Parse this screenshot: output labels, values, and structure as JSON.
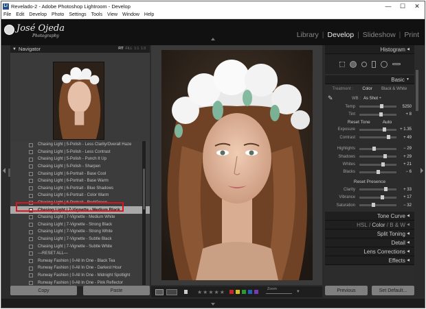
{
  "window": {
    "title": "Revelado-2 - Adobe Photoshop Lightroom - Develop",
    "app_badge": "Lr",
    "controls": {
      "minimize": "—",
      "maximize": "☐",
      "close": "✕"
    }
  },
  "menu": [
    "File",
    "Edit",
    "Develop",
    "Photo",
    "Settings",
    "Tools",
    "View",
    "Window",
    "Help"
  ],
  "identity": {
    "name": "José Ojeda",
    "subtitle": "Photography"
  },
  "modules": {
    "library": "Library",
    "develop": "Develop",
    "slideshow": "Slideshow",
    "print": "Print",
    "separator": "|",
    "active": "Develop"
  },
  "navigator": {
    "title": "Navigator",
    "zoom_options": {
      "fit": "FIT",
      "fill": "FILL",
      "one": "1:1",
      "three": "1:3"
    }
  },
  "presets": [
    "Chasing Light | 5-Polish - Less Clarity/Overall Haze",
    "Chasing Light | 5-Polish - Less Contrast",
    "Chasing Light | 5-Polish - Punch It Up",
    "Chasing Light | 5-Polish - Sharpen",
    "Chasing Light | 6-Portrait - Base Cool",
    "Chasing Light | 6-Portrait - Base Warm",
    "Chasing Light | 6-Portrait - Blue Shadows",
    "Chasing Light | 6-Portrait - Color Warm",
    "Chasing Light | 6-Portrait - Red/Green",
    "Chasing Light | 7-Vignette - Medium Black",
    "Chasing Light | 7-Vignette - Medium White",
    "Chasing Light | 7-Vignette - Strong Black",
    "Chasing Light | 7-Vignette - Strong White",
    "Chasing Light | 7-Vignette - Subtle Black",
    "Chasing Light | 7-Vignette - Subtle White",
    "—RESET ALL—",
    "Runway Fashion | 0-All In One - Black Tea",
    "Runway Fashion | 0-All In One - Darkest Hour",
    "Runway Fashion | 0-All In One - Midnight Spotlight",
    "Runway Fashion | 0-All In One - Pink Reflector"
  ],
  "selected_preset_index": 9,
  "left_buttons": {
    "copy": "Copy",
    "paste": "Paste"
  },
  "toolbar": {
    "zoom_label": "Zoom",
    "stars": "★★★★★",
    "color_labels": [
      "#c62828",
      "#d8c21c",
      "#2e9a36",
      "#2461b8",
      "#7a3bb0"
    ]
  },
  "right": {
    "histogram": "Histogram",
    "basic": "Basic",
    "treatment": {
      "label": "Treatment :",
      "color": "Color",
      "bw": "Black & White"
    },
    "wb": {
      "label": "WB :",
      "value": "As Shot ÷"
    },
    "temp": {
      "label": "Temp",
      "value": "5250",
      "level": 0.55
    },
    "tint": {
      "label": "Tint",
      "value": "+ 8",
      "level": 0.53
    },
    "tone_header": "Reset Tone",
    "auto": "Auto",
    "tone": [
      {
        "label": "Exposure",
        "value": "+ 1.35",
        "level": 0.63
      },
      {
        "label": "Contrast",
        "value": "+ 49",
        "level": 0.74
      },
      {
        "label": "Highlights",
        "value": "− 29",
        "level": 0.36
      },
      {
        "label": "Shadows",
        "value": "+ 29",
        "level": 0.64
      },
      {
        "label": "Whites",
        "value": "+ 21",
        "level": 0.6
      },
      {
        "label": "Blacks",
        "value": "− 6",
        "level": 0.47
      }
    ],
    "presence_header": "Reset Presence",
    "presence": [
      {
        "label": "Clarity",
        "value": "+ 33",
        "level": 0.66
      },
      {
        "label": "Vibrance",
        "value": "+ 17",
        "level": 0.58
      },
      {
        "label": "Saturation",
        "value": "− 32",
        "level": 0.34
      }
    ],
    "tone_curve": "Tone Curve",
    "hsl": {
      "hsl": "HSL",
      "color": "Color",
      "bw": "B & W",
      "sep": "/"
    },
    "split_toning": "Split Toning",
    "detail": "Detail",
    "lens": "Lens Corrections",
    "effects": "Effects",
    "previous": "Previous",
    "set_default": "Set Default..."
  }
}
